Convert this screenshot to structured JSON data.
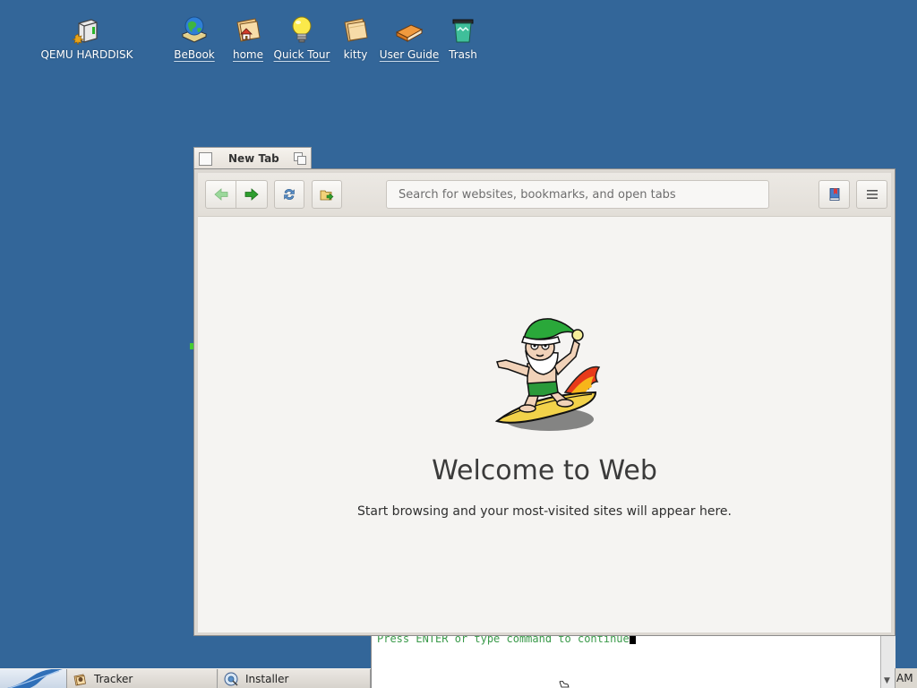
{
  "desktop": {
    "background_color": "#336699",
    "icons": [
      {
        "label": "QEMU HARDDISK",
        "icon": "harddisk-icon"
      },
      {
        "label": "BeBook",
        "icon": "bebook-icon"
      },
      {
        "label": "home",
        "icon": "home-folder-icon"
      },
      {
        "label": "Quick Tour",
        "icon": "lightbulb-icon"
      },
      {
        "label": "kitty",
        "icon": "folder-icon"
      },
      {
        "label": "User Guide",
        "icon": "book-icon"
      },
      {
        "label": "Trash",
        "icon": "trash-icon"
      }
    ]
  },
  "browser": {
    "tab_title": "New Tab",
    "search_placeholder": "Search for websites, bookmarks, and open tabs",
    "welcome_title": "Welcome to Web",
    "welcome_subtitle": "Start browsing and your most-visited sites will appear here.",
    "toolbar_icons": [
      "back-arrow-icon",
      "forward-arrow-icon",
      "reload-icon",
      "new-tab-icon",
      "bookmark-icon",
      "hamburger-menu-icon"
    ]
  },
  "terminal": {
    "text": "Press ENTER or type command to continue"
  },
  "taskbar": {
    "items": [
      {
        "label": "Tracker",
        "icon": "tracker-icon"
      },
      {
        "label": "Installer",
        "icon": "installer-icon"
      }
    ],
    "clock_fragment": "AM"
  },
  "colors": {
    "desktop": "#336699",
    "terminal_text": "#3a9a4a",
    "accent_green": "#2e9e2e"
  }
}
